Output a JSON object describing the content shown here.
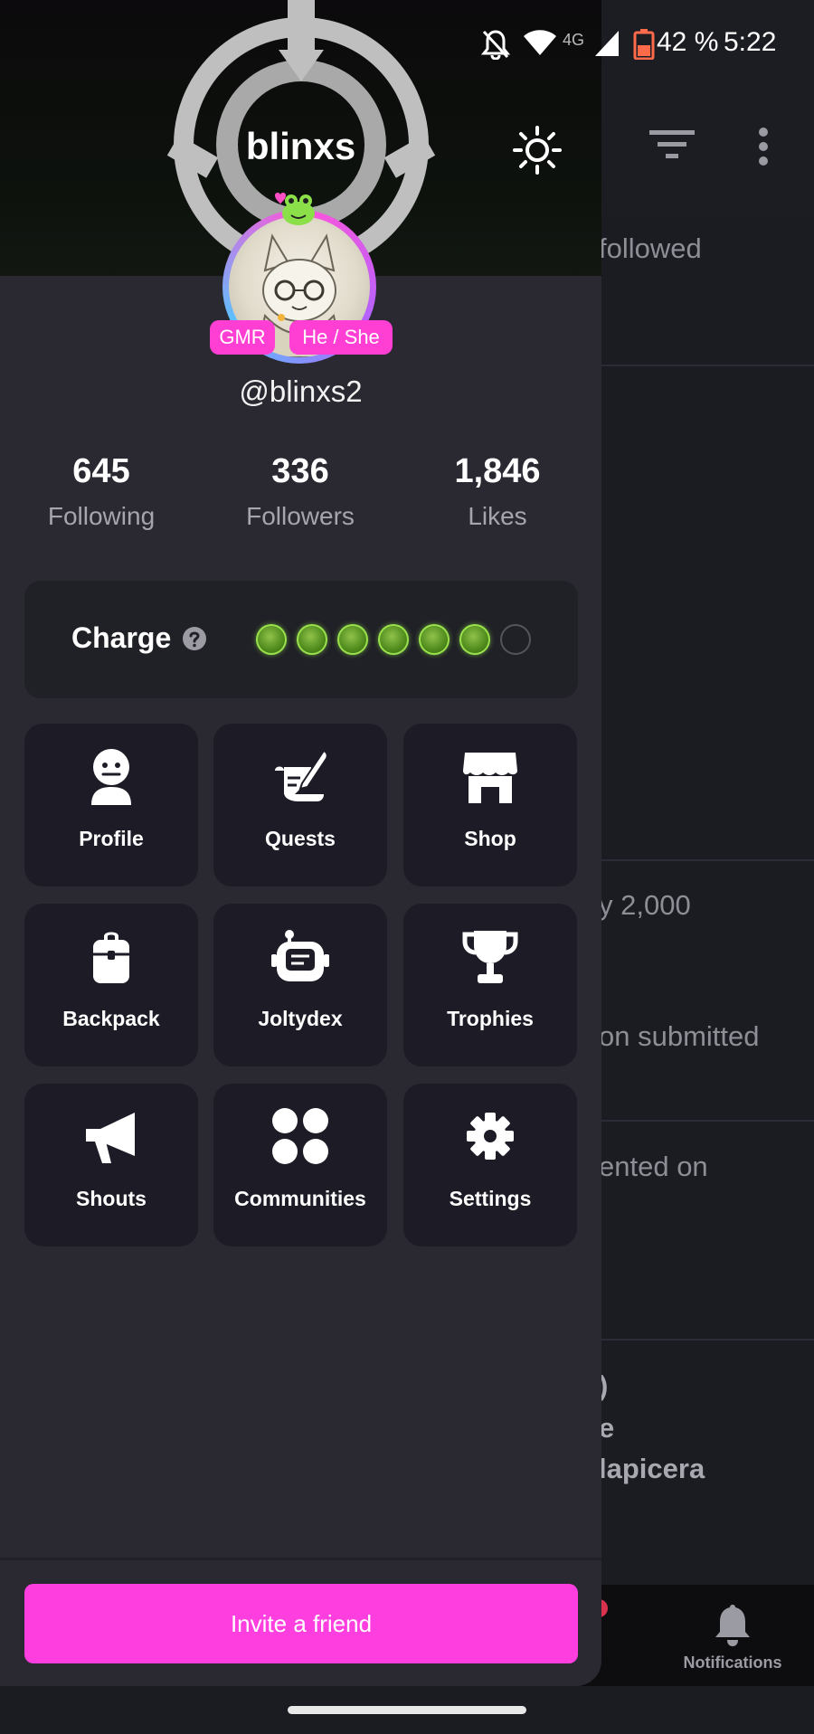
{
  "status_bar": {
    "network": "4G",
    "battery": "42 %",
    "time": "5:22"
  },
  "background_feed": {
    "rows": [
      {
        "text": "followed"
      },
      {
        "text": "y 2,000"
      },
      {
        "text": "on submitted"
      },
      {
        "text": "ented on"
      },
      {
        "text": ")"
      },
      {
        "text": "e"
      },
      {
        "text": "lapicera"
      }
    ],
    "bottom_nav": {
      "notifications_label": "Notifications"
    }
  },
  "drawer": {
    "title": "blinxs",
    "handle": "@blinxs2",
    "badges": {
      "gmr": "GMR",
      "pronouns": "He / She"
    },
    "stats": [
      {
        "value": "645",
        "label": "Following"
      },
      {
        "value": "336",
        "label": "Followers"
      },
      {
        "value": "1,846",
        "label": "Likes"
      }
    ],
    "charge": {
      "label": "Charge",
      "filled": 6,
      "total": 7
    },
    "menu": [
      {
        "label": "Profile",
        "icon": "profile-icon"
      },
      {
        "label": "Quests",
        "icon": "quests-icon"
      },
      {
        "label": "Shop",
        "icon": "shop-icon"
      },
      {
        "label": "Backpack",
        "icon": "backpack-icon"
      },
      {
        "label": "Joltydex",
        "icon": "joltydex-icon"
      },
      {
        "label": "Trophies",
        "icon": "trophy-icon"
      },
      {
        "label": "Shouts",
        "icon": "megaphone-icon"
      },
      {
        "label": "Communities",
        "icon": "communities-icon"
      },
      {
        "label": "Settings",
        "icon": "gear-icon"
      }
    ],
    "invite_label": "Invite a friend"
  },
  "colors": {
    "accent": "#ff3ee0",
    "drawer_bg": "#2a2932",
    "tile_bg": "#1d1c26",
    "badge": "#ff3ed3"
  }
}
